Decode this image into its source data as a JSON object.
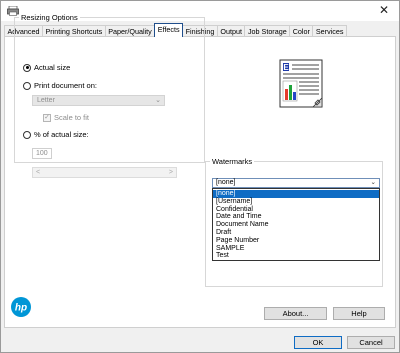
{
  "window": {
    "close_glyph": "✕"
  },
  "tabs": [
    {
      "label": "Advanced"
    },
    {
      "label": "Printing Shortcuts"
    },
    {
      "label": "Paper/Quality"
    },
    {
      "label": "Effects",
      "active": true
    },
    {
      "label": "Finishing"
    },
    {
      "label": "Output"
    },
    {
      "label": "Job Storage"
    },
    {
      "label": "Color"
    },
    {
      "label": "Services"
    }
  ],
  "resizing": {
    "legend": "Resizing Options",
    "actual_size_label": "Actual size",
    "actual_size_selected": true,
    "print_on_label": "Print document on:",
    "paper_value": "Letter",
    "scale_to_fit_label": "Scale to fit",
    "scale_to_fit_checked": true,
    "percent_label": "% of actual size:",
    "percent_value": "100"
  },
  "watermarks": {
    "legend": "Watermarks",
    "selected_value": "[none]",
    "options": [
      "[none]",
      "[Username]",
      "Confidential",
      "Date and Time",
      "Document Name",
      "Draft",
      "Page Number",
      "SAMPLE",
      "Test"
    ],
    "highlighted_index": 0
  },
  "buttons": {
    "about": "About...",
    "help": "Help",
    "ok": "OK",
    "cancel": "Cancel"
  },
  "colors": {
    "accent": "#1f4e8c",
    "selection": "#0f6cc4",
    "hp_blue": "#0096d6"
  },
  "icons": [
    "printer-icon",
    "close-icon",
    "chevron-down-icon",
    "document-preview-icon",
    "hp-logo"
  ]
}
